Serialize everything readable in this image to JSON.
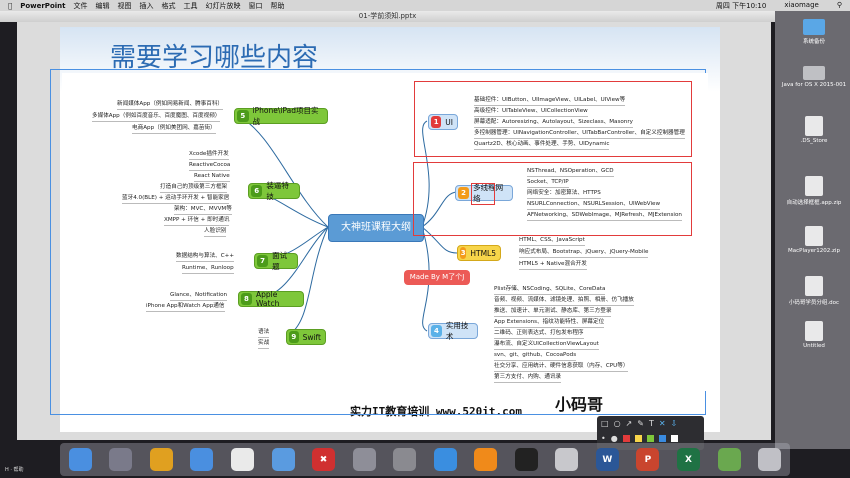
{
  "menubar": {
    "app": "PowerPoint",
    "items": [
      "文件",
      "编辑",
      "视图",
      "插入",
      "格式",
      "工具",
      "幻灯片放映",
      "窗口",
      "帮助"
    ],
    "clock": "周四 下午10:10",
    "user": "xiaomage"
  },
  "window": {
    "title": "01-学前须知.pptx"
  },
  "slide": {
    "title": "需要学习哪些内容",
    "footer": "实力IT教育培训 www.520it.com",
    "logo_text": "小码哥"
  },
  "mindmap": {
    "center": "大神班课程大纲",
    "made_by": "Made By M了个J",
    "left_topics": [
      {
        "num": "5",
        "label": "iPhone\\iPad项目实战",
        "leaves": [
          "新闻媒体App（例如网易新闻、腾事百科）",
          "多媒体App（例如百度音乐、百度魔图、百度视频）",
          "电商App（例如美团网、嘉苗街）"
        ]
      },
      {
        "num": "6",
        "label": "装逼特技",
        "leaves": [
          "Xcode插件开发",
          "ReactiveCocoa",
          "React Native",
          "打造自己的顶级第三方框架",
          "蓝牙4.0(BLE) + 运动手环开发 + 智能家居",
          "架构：MVC、MVVM等",
          "XMPP + 环信 + 即时通讯",
          "人脸识别"
        ]
      },
      {
        "num": "7",
        "label": "面试题",
        "leaves": [
          "数据结构与算法、C++",
          "Runtime、Runloop"
        ]
      },
      {
        "num": "8",
        "label": "Apple Watch",
        "leaves": [
          "Glance、Notification",
          "iPhone App和Watch App通信"
        ]
      },
      {
        "num": "9",
        "label": "Swift",
        "leaves": [
          "语法",
          "实战"
        ]
      }
    ],
    "right_topics": [
      {
        "num": "1",
        "label": "UI",
        "leaves": [
          "基础控件：UIButton、UIImageView、UILabel、UIView等",
          "高级控件：UITableView、UICollectionView",
          "屏幕适配：Autoresizing、Autolayout、Sizeclass、Masonry",
          "多控制器管理：UINavigationController、UITabBarController、自定义控制器管理",
          "Quartz2D、核心动画、事件处理、手势、UIDynamic"
        ]
      },
      {
        "num": "2",
        "label": "多线程网络",
        "leaves": [
          "NSThread、NSOperation、GCD",
          "Socket、TCP/IP",
          "网络安全：加密算法、HTTPS",
          "NSURLConnection、NSURLSession、UIWebView",
          "AFNetworking、SDWebImage、MJRefresh、MJExtension"
        ]
      },
      {
        "num": "3",
        "label": "HTML5",
        "leaves": [
          "HTML、CSS、JavaScript",
          "响应式布局、Bootstrap、jQuery、jQuery-Mobile",
          "HTML5 + Native混合开发"
        ]
      },
      {
        "num": "4",
        "label": "实用技术",
        "leaves": [
          "Plist存储、NSCoding、SQLite、CoreData",
          "音频、视频、流媒体、滤镜处理、拍照、相册、仿飞播放",
          "推送、加速计、单元测试、静态库、第三方登录",
          "App Extensions、指纹功能特性、屏幕定位",
          "二维码、正则表达式、打包发布程序",
          "瀑布流、自定义UICollectionViewLayout",
          "svn、git、github、CocoaPods",
          "社交分享、应用统计、硬件信息获取（内存、CPU等）",
          "第三方支付、内购、通讯录"
        ]
      }
    ]
  },
  "desktop": {
    "items": [
      "系统备份",
      "Java for OS X 2015-001",
      ".DS_Store",
      "自动选择框框.app.zip",
      "MacPlayer1202.zip",
      "小码哥学员分组.doc",
      "Untitled"
    ]
  },
  "dock": {
    "icons": [
      "finder-icon",
      "launchpad-icon",
      "chrome-icon",
      "mail-icon",
      "calendar-icon",
      "notes-icon",
      "xmind-icon",
      "keynote-icon",
      "settings-icon",
      "safari-icon",
      "vlc-icon",
      "terminal-icon",
      "preview-icon",
      "word-icon",
      "powerpoint-icon",
      "excel-icon",
      "photos-icon",
      "trash-icon"
    ],
    "labels": [
      "W",
      "P",
      "X"
    ]
  },
  "annotation_toolbar": {
    "colors": [
      "#e23b3b",
      "#f7d54a",
      "#7ec73a",
      "#3a8be0",
      "#ffffff",
      "#000000"
    ]
  },
  "status": {
    "bottom_left": "H · 帮助"
  }
}
